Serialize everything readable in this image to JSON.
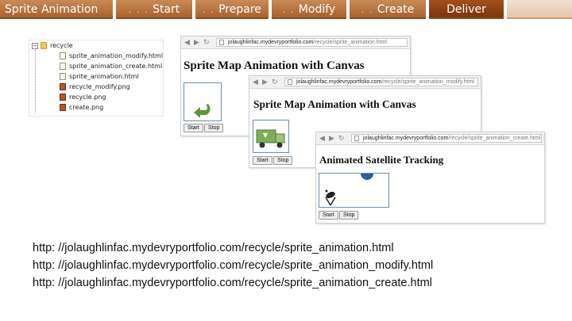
{
  "tabs": [
    {
      "label": "Sprite Animation",
      "prefix": ""
    },
    {
      "label": "Start",
      "prefix": ". . ."
    },
    {
      "label": "Prepare",
      "prefix": ". ."
    },
    {
      "label": "Modify",
      "prefix": ". ."
    },
    {
      "label": "Create",
      "prefix": ". ."
    },
    {
      "label": "Deliver",
      "prefix": ""
    }
  ],
  "filetree": {
    "items": [
      {
        "label": "recycle",
        "icon": "folder-icon"
      },
      {
        "label": "sprite_animation_modify.html",
        "icon": "html-file-icon"
      },
      {
        "label": "sprite_animation_create.html",
        "icon": "html-file-icon"
      },
      {
        "label": "sprite_animation.html",
        "icon": "html-file-icon"
      },
      {
        "label": "recycle_modify.png",
        "icon": "png-file-icon"
      },
      {
        "label": "recycle.png",
        "icon": "png-file-icon"
      },
      {
        "label": "create.png",
        "icon": "png-file-icon"
      }
    ]
  },
  "browsers": [
    {
      "url_host": "jolaughlinfac.mydevryportfolio.com",
      "url_path": "/recycle/sprite_animation.html",
      "title": "Sprite Map Animation with Canvas",
      "start_label": "Start",
      "stop_label": "Stop"
    },
    {
      "url_host": "jolaughlinfac.mydevryportfolio.com",
      "url_path": "/recycle/sprite_animation_modify.html",
      "title": "Sprite Map Animation with Canvas",
      "start_label": "Start",
      "stop_label": "Stop"
    },
    {
      "url_host": "jolaughlinfac.mydevryportfolio.com",
      "url_path": "/recycle/sprite_animation_create.html",
      "title": "Animated Satellite Tracking",
      "start_label": "Start",
      "stop_label": "Stop"
    }
  ],
  "urls": [
    "http: //jolaughlinfac.mydevryportfolio.com/recycle/sprite_animation.html",
    "http: //jolaughlinfac.mydevryportfolio.com/recycle/sprite_animation_modify.html",
    "http: //jolaughlinfac.mydevryportfolio.com/recycle/sprite_animation_create.html"
  ],
  "colors": {
    "tab": "#b8713a",
    "tab_active": "#8f4214",
    "canvas_border": "#6b8db4",
    "arrow_green": "#5a9a3a",
    "satellite_blue": "#2f5ea8"
  }
}
